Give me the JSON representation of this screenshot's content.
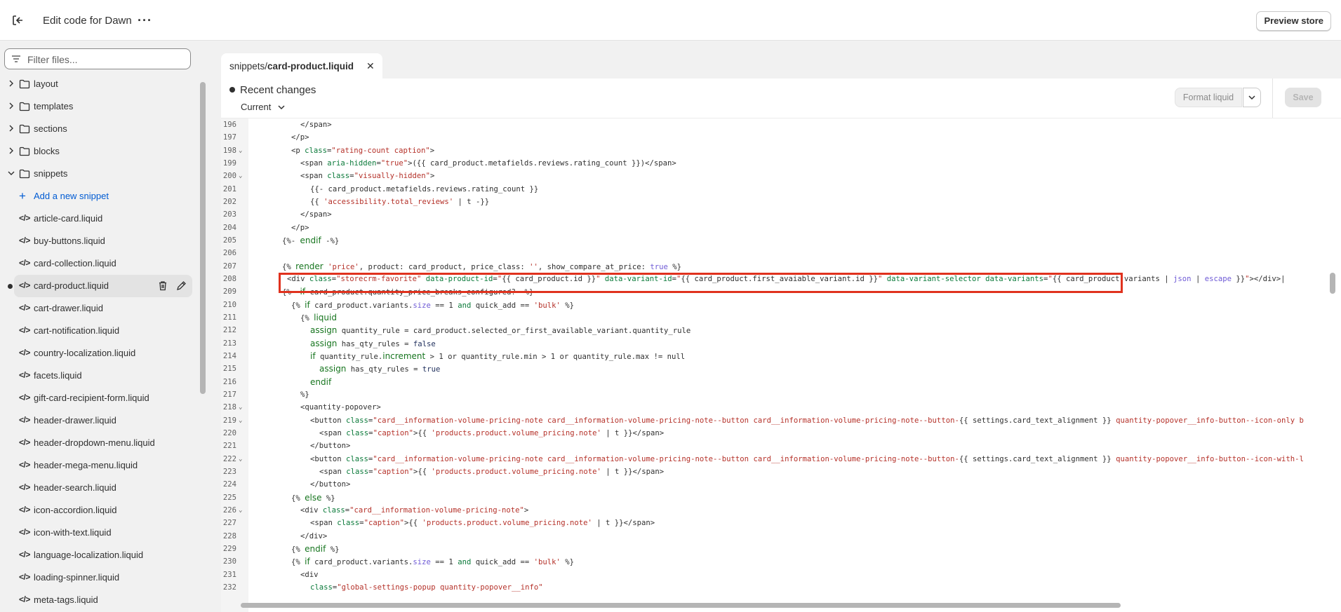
{
  "header": {
    "title": "Edit code for Dawn",
    "preview_label": "Preview store"
  },
  "sidebar": {
    "filter_placeholder": "Filter files...",
    "folders": [
      {
        "label": "layout",
        "expanded": false
      },
      {
        "label": "templates",
        "expanded": false
      },
      {
        "label": "sections",
        "expanded": false
      },
      {
        "label": "blocks",
        "expanded": false
      },
      {
        "label": "snippets",
        "expanded": true
      }
    ],
    "add_snippet_label": "Add a new snippet",
    "files": [
      "article-card.liquid",
      "buy-buttons.liquid",
      "card-collection.liquid",
      "card-product.liquid",
      "cart-drawer.liquid",
      "cart-notification.liquid",
      "country-localization.liquid",
      "facets.liquid",
      "gift-card-recipient-form.liquid",
      "header-drawer.liquid",
      "header-dropdown-menu.liquid",
      "header-mega-menu.liquid",
      "header-search.liquid",
      "icon-accordion.liquid",
      "icon-with-text.liquid",
      "language-localization.liquid",
      "loading-spinner.liquid",
      "meta-tags.liquid"
    ],
    "active_file": "card-product.liquid",
    "code_glyph": "</>"
  },
  "editor": {
    "tab_prefix": "snippets/",
    "tab_name": "card-product.liquid",
    "recent_changes": "Recent changes",
    "version_label": "Current",
    "format_label": "Format liquid",
    "save_label": "Save"
  },
  "code": {
    "line_numbers": [
      "196",
      "197",
      "198",
      "199",
      "200",
      "201",
      "202",
      "203",
      "204",
      "205",
      "206",
      "207",
      "208",
      "209",
      "210",
      "211",
      "212",
      "213",
      "214",
      "215",
      "216",
      "217",
      "218",
      "219",
      "220",
      "221",
      "222",
      "223",
      "224",
      "225",
      "226",
      "227",
      "228",
      "229",
      "230",
      "231",
      "232"
    ],
    "highlighted_line": "208"
  },
  "colors": {
    "accent_link": "#005bd3",
    "highlight_border": "#e0321e"
  }
}
